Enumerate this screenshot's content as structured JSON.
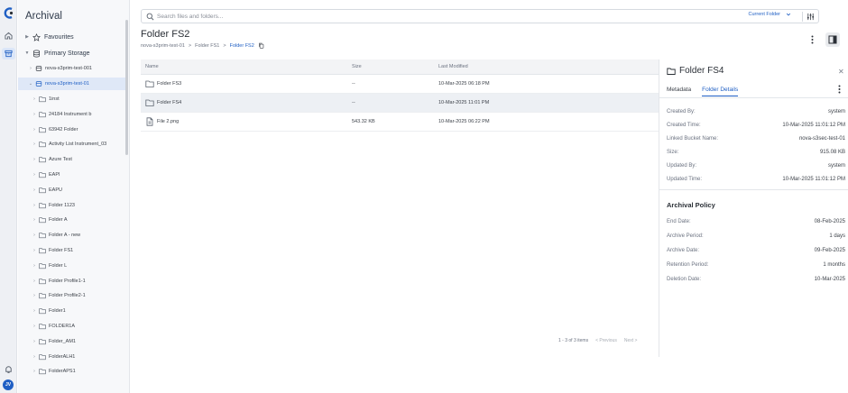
{
  "colors": {
    "accent": "#1f5fc4",
    "selected_bg": "#dfe8f7",
    "avatar": "#1f5fc4"
  },
  "rail": {
    "items": [
      {
        "icon": "home-icon"
      },
      {
        "icon": "archive-icon",
        "active": true
      }
    ],
    "avatar_initials": "JV"
  },
  "nav": {
    "title": "Archival",
    "favourites": "Favourites",
    "primary_storage": "Primary Storage",
    "buckets": [
      "nova-s3prim-test-001",
      "nova-s3prim-test-01"
    ],
    "folders": [
      "1inst",
      "24184 Instrument b",
      "63942 Folder",
      "Activity List Instrument_03",
      "Azure Test",
      "EAPI",
      "EAPU",
      "Folder 1123",
      "Folder A",
      "Folder A - new",
      "Folder FS1",
      "Folder L",
      "Folder Profile1-1",
      "Folder Profile2-1",
      "Folder1",
      "FOLDER1A",
      "Folder_AM1",
      "FolderALH1",
      "FolderAPS1"
    ]
  },
  "search": {
    "placeholder": "Search files and folders...",
    "scope": "Current Folder"
  },
  "page": {
    "title": "Folder FS2",
    "breadcrumb": [
      "nova-s3prim-test-01",
      "Folder FS1",
      "Folder FS2"
    ]
  },
  "table": {
    "headers": {
      "name": "Name",
      "size": "Size",
      "modified": "Last Modified"
    },
    "rows": [
      {
        "name": "Folder FS3",
        "size": "--",
        "modified": "10-Mar-2025 06:18 PM",
        "type": "folder"
      },
      {
        "name": "Folder FS4",
        "size": "--",
        "modified": "10-Mar-2025 11:01 PM",
        "type": "folder"
      },
      {
        "name": "File 2.png",
        "size": "543.32 KB",
        "modified": "10-Mar-2025 06:22 PM",
        "type": "file"
      }
    ]
  },
  "pager": {
    "summary": "1 - 3 of 3 items",
    "previous": "< Previous",
    "next": "Next >"
  },
  "details": {
    "title": "Folder FS4",
    "tabs": [
      "Metadata",
      "Folder Details"
    ],
    "fields": [
      {
        "label": "Created By:",
        "value": "system"
      },
      {
        "label": "Created Time:",
        "value": "10-Mar-2025 11:01:12 PM"
      },
      {
        "label": "Linked Bucket Name:",
        "value": "nova-s3sec-test-01"
      },
      {
        "label": "Size:",
        "value": "915.08 KB"
      },
      {
        "label": "Updated By:",
        "value": "system"
      },
      {
        "label": "Updated Time:",
        "value": "10-Mar-2025 11:01:12 PM"
      }
    ],
    "policy_title": "Archival Policy",
    "policy": [
      {
        "label": "End Date:",
        "value": "08-Feb-2025"
      },
      {
        "label": "Archive Period:",
        "value": "1 days"
      },
      {
        "label": "Archive Date:",
        "value": "09-Feb-2025"
      },
      {
        "label": "Retention Period:",
        "value": "1 months"
      },
      {
        "label": "Deletion Date:",
        "value": "10-Mar-2025"
      }
    ]
  }
}
